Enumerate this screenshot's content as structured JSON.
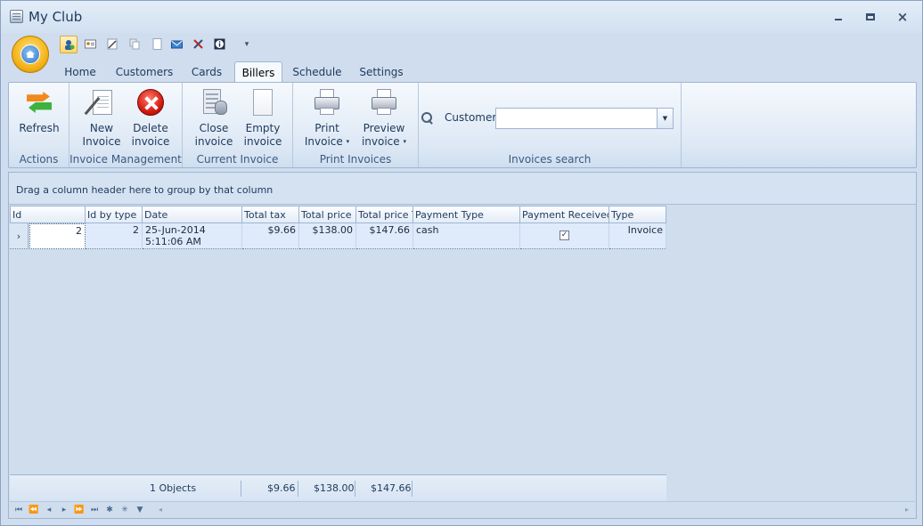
{
  "window": {
    "title": "My Club",
    "minimize_label": "",
    "maximize_label": "",
    "close_label": "×"
  },
  "quick_access": {
    "items": [
      "users-icon",
      "contact-card-icon",
      "edit-icon",
      "copy-icon",
      "page-icon",
      "mail-icon",
      "tools-icon",
      "info-icon"
    ],
    "customize_label": "▾"
  },
  "tabs": [
    "Home",
    "Customers",
    "Cards",
    "Billers",
    "Schedule",
    "Settings"
  ],
  "selected_tab": "Billers",
  "ribbon": {
    "actions": {
      "group_label": "Actions",
      "refresh_label": "Refresh"
    },
    "invoice_management": {
      "group_label": "Invoice Management",
      "new_line1": "New",
      "new_line2": "Invoice",
      "delete_line1": "Delete",
      "delete_line2": "invoice"
    },
    "current_invoice": {
      "group_label": "Current Invoice",
      "close_line1": "Close",
      "close_line2": "invoice",
      "empty_line1": "Empty",
      "empty_line2": "invoice"
    },
    "print_invoices": {
      "group_label": "Print Invoices",
      "print_line1": "Print",
      "print_line2": "Invoice",
      "preview_line1": "Preview",
      "preview_line2": "invoice",
      "dropdown_glyph": "▾"
    },
    "invoices_search": {
      "group_label": "Invoices search",
      "customer_label": "Customer",
      "customer_value": "",
      "dropdown_glyph": "▼"
    }
  },
  "grid": {
    "group_hint": "Drag a column header here to group by that column",
    "columns": [
      "Id",
      "Id by type",
      "Date",
      "Total tax",
      "Total price H",
      "Total price T",
      "Payment Type",
      "Payment Received",
      "Type"
    ],
    "rows": [
      {
        "indicator": "›",
        "id": "2",
        "id_by_type": "2",
        "date": "25-Jun-2014 5:11:06 AM",
        "total_tax": "$9.66",
        "total_price_h": "$138.00",
        "total_price_t": "$147.66",
        "payment_type": "cash",
        "payment_received": true,
        "payment_received_glyph": "✓",
        "type": "Invoice"
      }
    ],
    "footer": {
      "count": "1 Objects",
      "total_tax": "$9.66",
      "total_price_h": "$138.00",
      "total_price_t": "$147.66"
    },
    "navigator": {
      "first": "⏮",
      "prev_page": "⏪",
      "prev": "◂",
      "next": "▸",
      "next_page": "⏩",
      "last": "⏭",
      "append": "✱",
      "edit": "✳",
      "filter": "▼",
      "scroll_left": "◂",
      "scroll_right": "▸"
    }
  },
  "colors": {
    "accent": "#1e395b",
    "selection": "#dfeafb",
    "border": "#9fb6d2"
  }
}
